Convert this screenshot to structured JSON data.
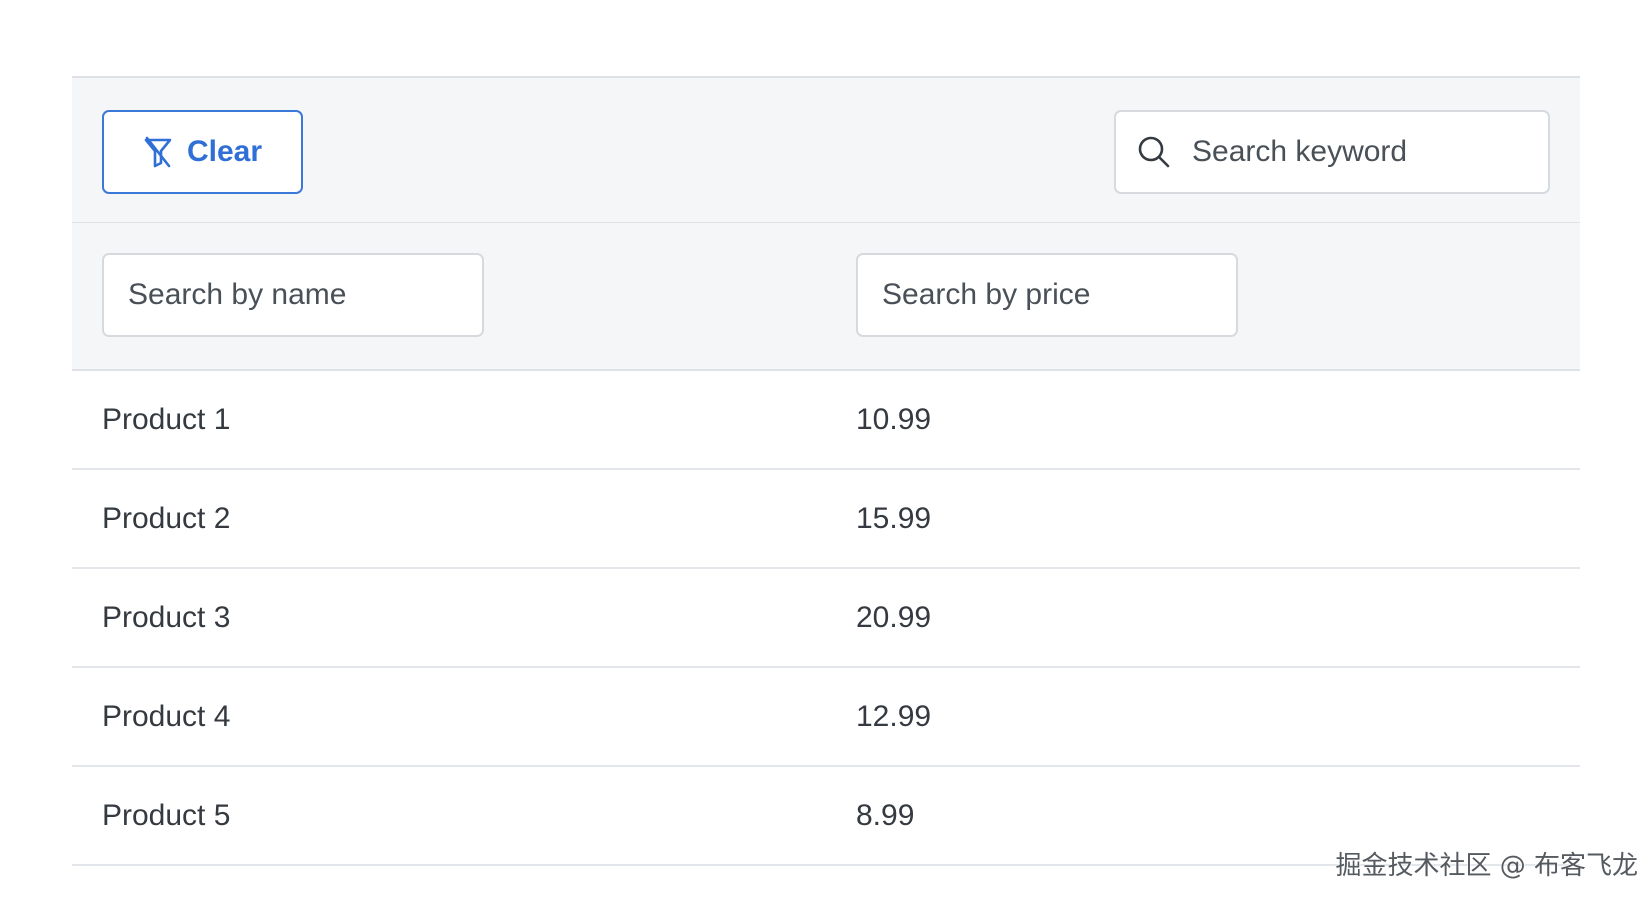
{
  "toolbar": {
    "clear_label": "Clear",
    "keyword_placeholder": "Search keyword"
  },
  "filters": {
    "name_placeholder": "Search by name",
    "price_placeholder": "Search by price"
  },
  "rows": [
    {
      "name": "Product 1",
      "price": "10.99"
    },
    {
      "name": "Product 2",
      "price": "15.99"
    },
    {
      "name": "Product 3",
      "price": "20.99"
    },
    {
      "name": "Product 4",
      "price": "12.99"
    },
    {
      "name": "Product 5",
      "price": "8.99"
    }
  ],
  "watermark": "掘金技术社区 @ 布客飞龙",
  "colors": {
    "accent": "#2f6fd6",
    "header_bg": "#f4f6f8",
    "border": "#dee2e6"
  },
  "icons": {
    "clear": "filter-slash-icon",
    "search": "search-icon"
  }
}
